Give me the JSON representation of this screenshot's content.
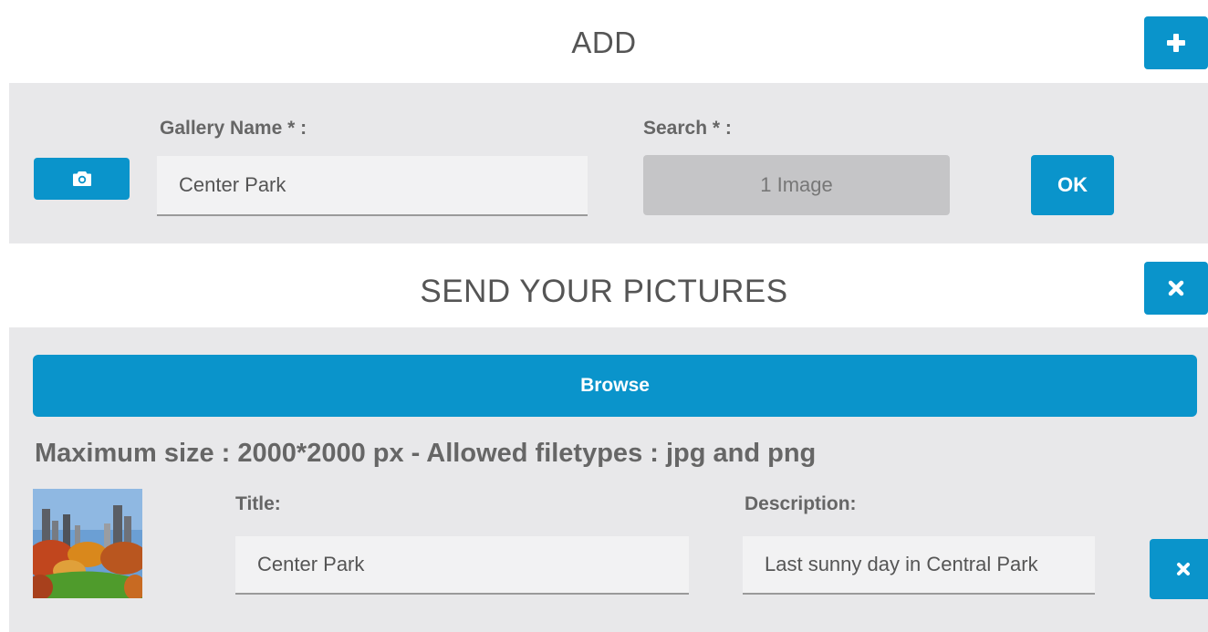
{
  "add_section": {
    "title": "ADD",
    "gallery_label": "Gallery Name * :",
    "gallery_value": "Center Park",
    "search_label": "Search * :",
    "search_value": "1 Image",
    "ok_label": "OK"
  },
  "send_section": {
    "title": "SEND YOUR PICTURES",
    "browse_label": "Browse",
    "info": "Maximum size : 2000*2000 px - Allowed filetypes : jpg and png",
    "item": {
      "title_label": "Title:",
      "title_value": "Center Park",
      "description_label": "Description:",
      "description_value": "Last sunny day in Central Park"
    }
  },
  "icons": {
    "add": "plus-icon",
    "camera": "camera-icon",
    "close_section": "close-icon",
    "remove_item": "close-icon"
  },
  "colors": {
    "accent": "#0a94cb",
    "panel_bg": "#e8e8ea",
    "input_bg": "#f2f2f3",
    "disabled_bg": "#c5c5c7"
  }
}
